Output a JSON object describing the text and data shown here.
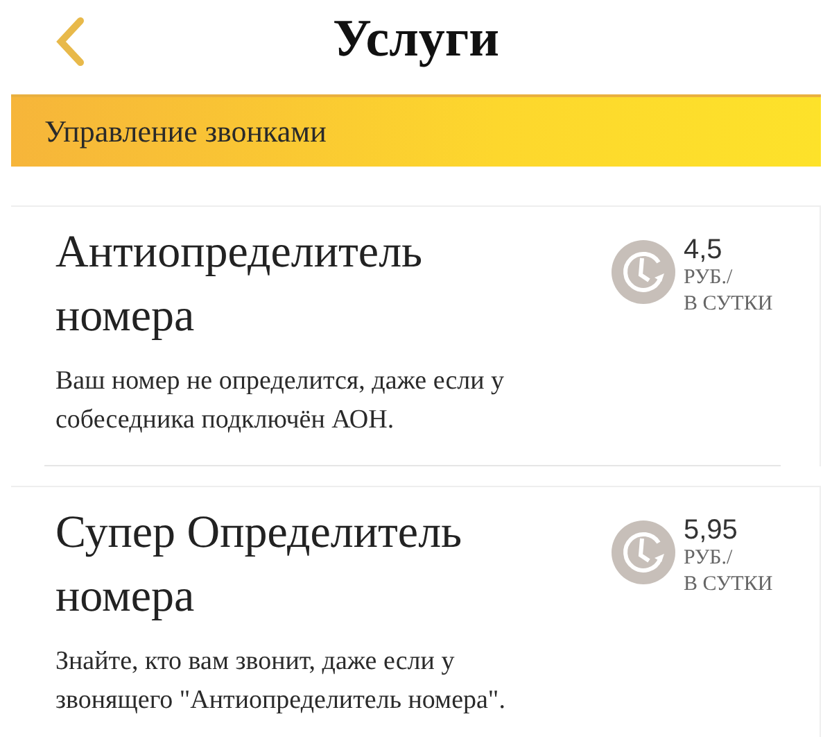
{
  "header": {
    "title": "Услуги"
  },
  "section": {
    "title": "Управление звонками"
  },
  "services": [
    {
      "title": "Антиопределитель номера",
      "description": "Ваш номер не определится, даже если у собеседника подключён АОН.",
      "price": "4,5",
      "unit": "РУБ./",
      "period": "В СУТКИ"
    },
    {
      "title": "Супер Определитель номера",
      "description": "Знайте, кто вам звонит, даже если у звонящего \"Антиопределитель номера\".",
      "price": "5,95",
      "unit": "РУБ./",
      "period": "В СУТКИ"
    }
  ]
}
